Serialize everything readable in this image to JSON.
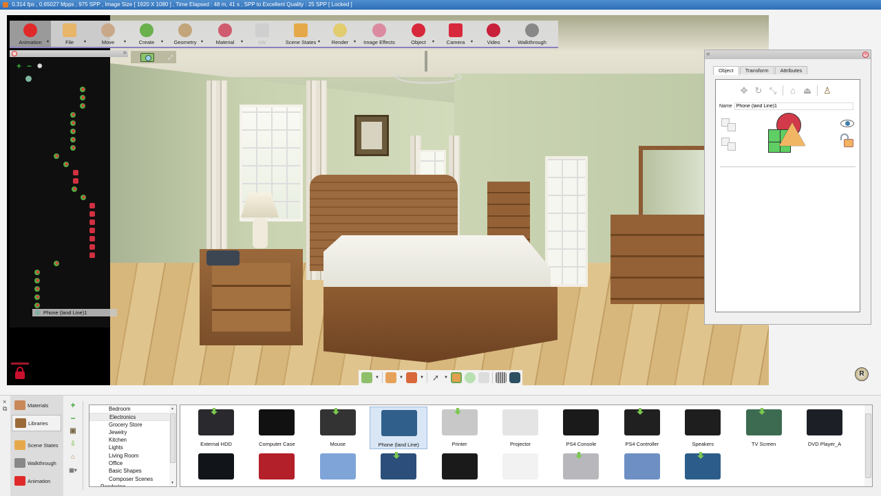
{
  "status_bar": {
    "text": "0.314 fps ,  0.65027 Mpps  ,  975 SPP   ,  Image Size [ 1920 X 1080 ] , Time Elapsed : 48 m, 41 s , SPP to Excellent Quality : 25 SPP  [ Locked ]"
  },
  "ribbon": {
    "items": [
      {
        "label": "Animation",
        "icon": "animation-icon",
        "active": true,
        "dropdown": true
      },
      {
        "label": "File",
        "icon": "folder-icon",
        "dropdown": true
      },
      {
        "label": "Move",
        "icon": "move-icon",
        "dropdown": true
      },
      {
        "label": "Create",
        "icon": "cube-create-icon",
        "dropdown": true
      },
      {
        "label": "Geometry",
        "icon": "sphere-wire-icon",
        "dropdown": true
      },
      {
        "label": "Material",
        "icon": "material-paint-icon",
        "dropdown": true
      },
      {
        "label": "UV",
        "icon": "uv-checker-icon",
        "disabled": true
      },
      {
        "label": "Scene States",
        "icon": "scene-states-icon",
        "dropdown": true
      },
      {
        "label": "Render",
        "icon": "render-icon",
        "dropdown": true
      },
      {
        "label": "Image Effects",
        "icon": "image-effects-icon"
      },
      {
        "label": "Object",
        "icon": "object-icon",
        "dropdown": true
      },
      {
        "label": "Camera",
        "icon": "camera-icon",
        "dropdown": true
      },
      {
        "label": "Video",
        "icon": "video-camera-icon",
        "dropdown": true
      },
      {
        "label": "Walkthrough",
        "icon": "footprints-icon"
      }
    ]
  },
  "scene_tree": {
    "add_label": "+",
    "remove_label": "−",
    "selected_item": "Phone (land Line)1"
  },
  "properties": {
    "tabs": [
      {
        "label": "Object",
        "active": true
      },
      {
        "label": "Transform"
      },
      {
        "label": "Attributes"
      }
    ],
    "name_label": "Name",
    "name_value": "Phone (land Line)1"
  },
  "library": {
    "side_tabs": [
      {
        "label": "Materials",
        "icon": "materials-icon"
      },
      {
        "label": "Libraries",
        "icon": "books-icon",
        "active": true
      },
      {
        "label": "Scene States",
        "icon": "scene-states-icon"
      },
      {
        "label": "Walkthrough",
        "icon": "footprints-icon"
      },
      {
        "label": "Animation",
        "icon": "animation-icon"
      }
    ],
    "categories": [
      "Bedroom",
      "Electronics",
      "Grocery Store",
      "Jewelry",
      "Kitchen",
      "Lights",
      "Living Room",
      "Office",
      "Basic Shapes",
      "Composer Scenes",
      "Rendering"
    ],
    "selected_category": "Electronics",
    "items_row1": [
      {
        "label": "External HDD",
        "color": "#2a2a2e",
        "download": true
      },
      {
        "label": "Computer Case",
        "color": "#111111"
      },
      {
        "label": "Mouse",
        "color": "#333333",
        "download": true
      },
      {
        "label": "Phone (land Line)",
        "color": "#2f5f8a",
        "selected": true
      },
      {
        "label": "Printer",
        "color": "#c8c8c8",
        "download": true
      },
      {
        "label": "Projector",
        "color": "#e4e4e4"
      },
      {
        "label": "PS4 Console",
        "color": "#1a1a1a"
      },
      {
        "label": "PS4 Controller",
        "color": "#202020",
        "download": true
      },
      {
        "label": "Speakers",
        "color": "#1e1e1e"
      },
      {
        "label": "TV Screen",
        "color": "#3d6b52",
        "download": true
      },
      {
        "label": "DVD Player_A",
        "color": "#1c1f26"
      }
    ],
    "items_row2": [
      {
        "label": "",
        "color": "#111418"
      },
      {
        "label": "",
        "color": "#b3202a"
      },
      {
        "label": "",
        "color": "#7fa4d8"
      },
      {
        "label": "",
        "color": "#2b4f7a",
        "download": true
      },
      {
        "label": "",
        "color": "#1a1a1a"
      },
      {
        "label": "",
        "color": "#f2f2f2"
      },
      {
        "label": "",
        "color": "#b8b8bc",
        "download": true
      },
      {
        "label": "",
        "color": "#6d8fc4"
      },
      {
        "label": "",
        "color": "#2c5d8a",
        "download": true
      }
    ]
  },
  "colors": {
    "accent_red": "#c8102e",
    "tree_green": "#37b437",
    "ribbon_underline": "#8a80c0"
  }
}
